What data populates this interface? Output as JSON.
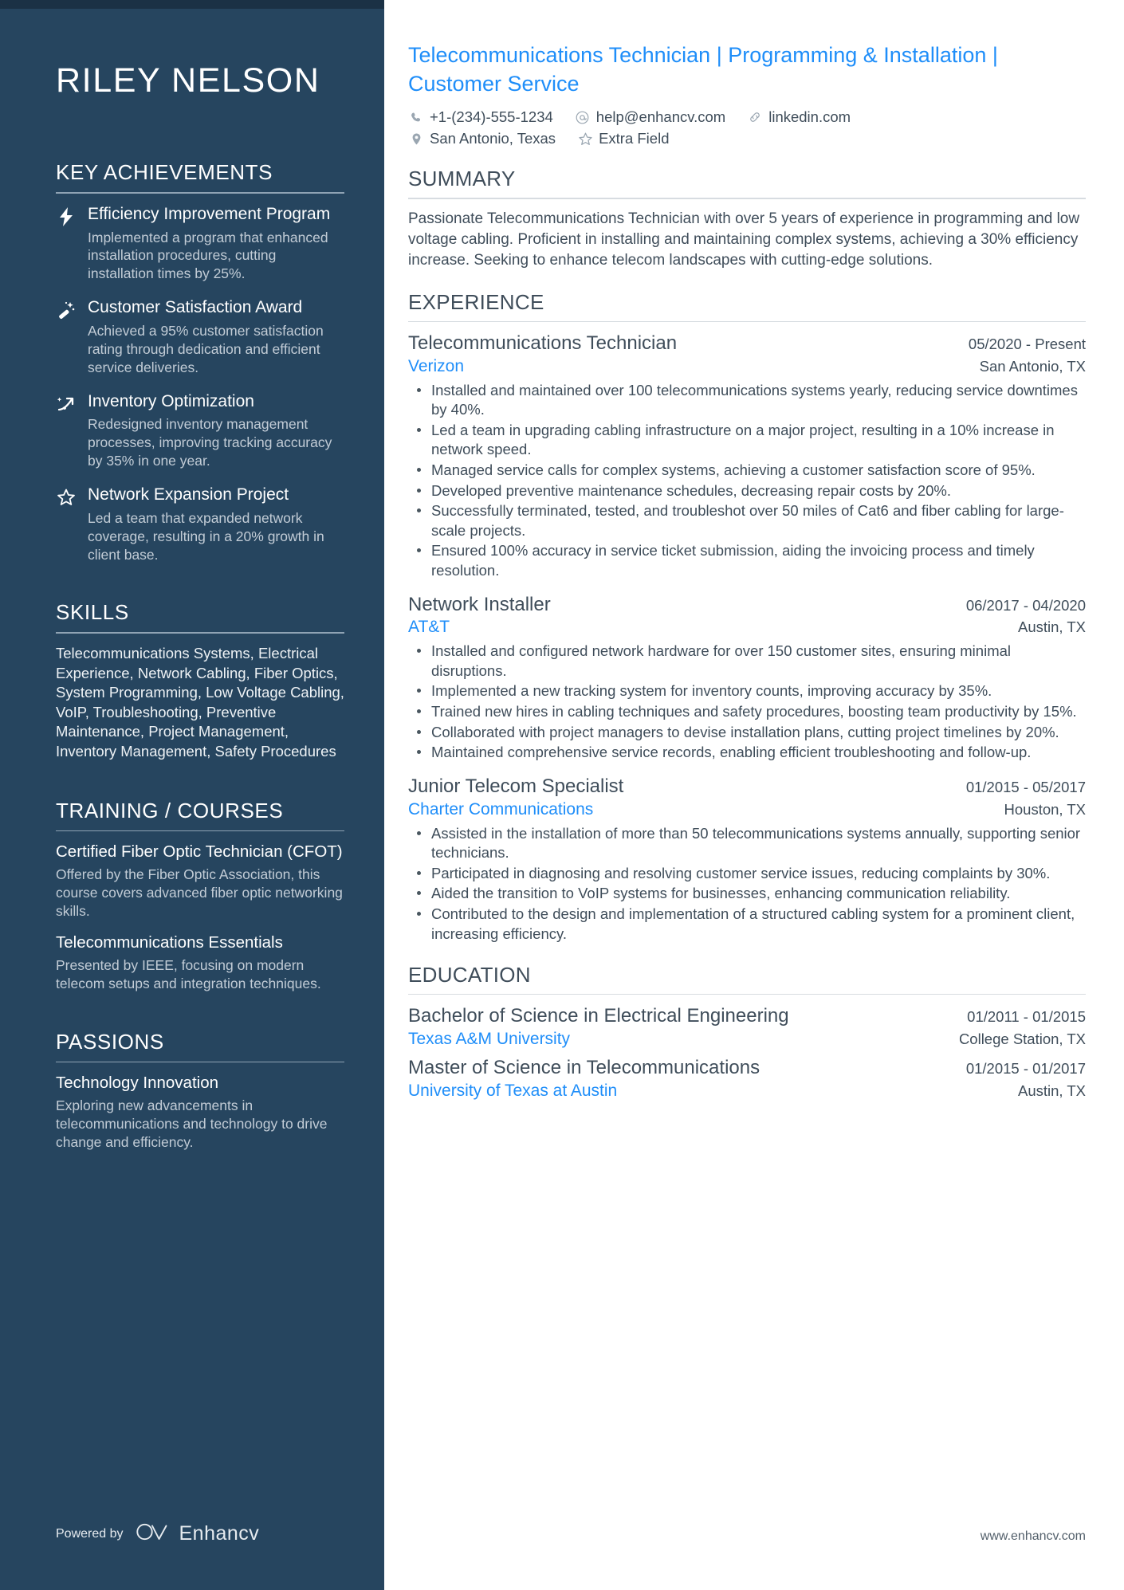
{
  "colors": {
    "sidebar_bg": "#26455f",
    "sidebar_top_strip": "#1b3145",
    "accent_blue": "#1f8ef9",
    "body_text": "#3f4d5a",
    "muted_sidebar_text": "#c2ccd6"
  },
  "candidate": {
    "name": "RILEY NELSON",
    "headline": "Telecommunications Technician | Programming & Installation | Customer Service"
  },
  "contact": {
    "phone": {
      "icon": "phone-icon",
      "value": "+1-(234)-555-1234"
    },
    "email": {
      "icon": "at-icon",
      "value": "help@enhancv.com"
    },
    "link": {
      "icon": "link-icon",
      "value": "linkedin.com"
    },
    "location": {
      "icon": "map-pin-icon",
      "value": "San Antonio, Texas"
    },
    "extra": {
      "icon": "star-icon",
      "value": "Extra Field"
    }
  },
  "sidebar": {
    "key_achievements": {
      "heading": "KEY ACHIEVEMENTS",
      "items": [
        {
          "icon": "lightning-bolt-icon",
          "title": "Efficiency Improvement Program",
          "description": "Implemented a program that enhanced installation procedures, cutting installation times by 25%."
        },
        {
          "icon": "magic-wand-icon",
          "title": "Customer Satisfaction Award",
          "description": "Achieved a 95% customer satisfaction rating through dedication and efficient service deliveries."
        },
        {
          "icon": "trend-arrow-icon",
          "title": "Inventory Optimization",
          "description": "Redesigned inventory management processes, improving tracking accuracy by 35% in one year."
        },
        {
          "icon": "star-icon",
          "title": "Network Expansion Project",
          "description": "Led a team that expanded network coverage, resulting in a 20% growth in client base."
        }
      ]
    },
    "skills": {
      "heading": "SKILLS",
      "text": "Telecommunications Systems, Electrical Experience, Network Cabling, Fiber Optics, System Programming, Low Voltage Cabling, VoIP, Troubleshooting, Preventive Maintenance, Project Management, Inventory Management, Safety Procedures"
    },
    "training": {
      "heading": "TRAINING / COURSES",
      "items": [
        {
          "title": "Certified Fiber Optic Technician (CFOT)",
          "description": "Offered by the Fiber Optic Association, this course covers advanced fiber optic networking skills."
        },
        {
          "title": "Telecommunications Essentials",
          "description": "Presented by IEEE, focusing on modern telecom setups and integration techniques."
        }
      ]
    },
    "passions": {
      "heading": "PASSIONS",
      "items": [
        {
          "title": "Technology Innovation",
          "description": "Exploring new advancements in telecommunications and technology to drive change and efficiency."
        }
      ]
    },
    "footer": {
      "powered_by": "Powered by",
      "brand": "Enhancv",
      "logo_icon": "enhancv-logo-icon"
    }
  },
  "main": {
    "summary": {
      "heading": "SUMMARY",
      "text": "Passionate Telecommunications Technician with over 5 years of experience in programming and low voltage cabling. Proficient in installing and maintaining complex systems, achieving a 30% efficiency increase. Seeking to enhance telecom landscapes with cutting-edge solutions."
    },
    "experience": {
      "heading": "EXPERIENCE",
      "jobs": [
        {
          "title": "Telecommunications Technician",
          "date": "05/2020 - Present",
          "company": "Verizon",
          "location": "San Antonio, TX",
          "bullets": [
            "Installed and maintained over 100 telecommunications systems yearly, reducing service downtimes by 40%.",
            "Led a team in upgrading cabling infrastructure on a major project, resulting in a 10% increase in network speed.",
            "Managed service calls for complex systems, achieving a customer satisfaction score of 95%.",
            "Developed preventive maintenance schedules, decreasing repair costs by 20%.",
            "Successfully terminated, tested, and troubleshot over 50 miles of Cat6 and fiber cabling for large-scale projects.",
            "Ensured 100% accuracy in service ticket submission, aiding the invoicing process and timely resolution."
          ]
        },
        {
          "title": "Network Installer",
          "date": "06/2017 - 04/2020",
          "company": "AT&T",
          "location": "Austin, TX",
          "bullets": [
            "Installed and configured network hardware for over 150 customer sites, ensuring minimal disruptions.",
            "Implemented a new tracking system for inventory counts, improving accuracy by 35%.",
            "Trained new hires in cabling techniques and safety procedures, boosting team productivity by 15%.",
            "Collaborated with project managers to devise installation plans, cutting project timelines by 20%.",
            "Maintained comprehensive service records, enabling efficient troubleshooting and follow-up."
          ]
        },
        {
          "title": "Junior Telecom Specialist",
          "date": "01/2015 - 05/2017",
          "company": "Charter Communications",
          "location": "Houston, TX",
          "bullets": [
            "Assisted in the installation of more than 50 telecommunications systems annually, supporting senior technicians.",
            "Participated in diagnosing and resolving customer service issues, reducing complaints by 30%.",
            "Aided the transition to VoIP systems for businesses, enhancing communication reliability.",
            "Contributed to the design and implementation of a structured cabling system for a prominent client, increasing efficiency."
          ]
        }
      ]
    },
    "education": {
      "heading": "EDUCATION",
      "entries": [
        {
          "degree": "Bachelor of Science in Electrical Engineering",
          "date": "01/2011 - 01/2015",
          "school": "Texas A&M University",
          "location": "College Station, TX"
        },
        {
          "degree": "Master of Science in Telecommunications",
          "date": "01/2015 - 01/2017",
          "school": "University of Texas at Austin",
          "location": "Austin, TX"
        }
      ]
    },
    "footer_site": "www.enhancv.com"
  }
}
